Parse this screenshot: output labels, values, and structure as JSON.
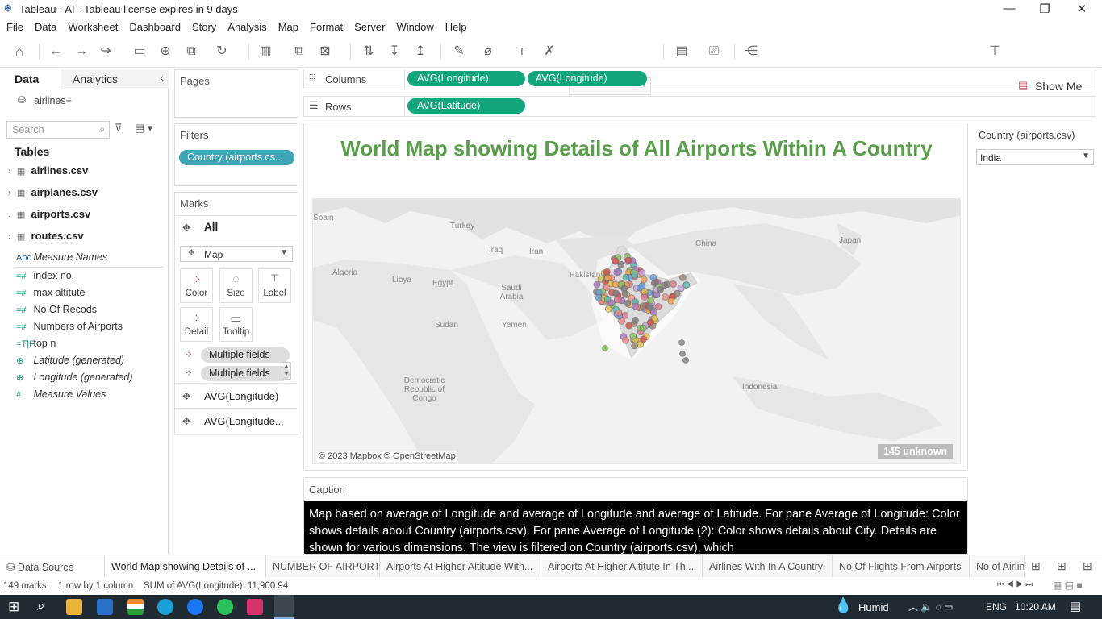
{
  "window": {
    "title": "Tableau - AI - Tableau license expires in 9 days"
  },
  "menu": [
    "File",
    "Data",
    "Worksheet",
    "Dashboard",
    "Story",
    "Analysis",
    "Map",
    "Format",
    "Server",
    "Window",
    "Help"
  ],
  "toolbar": {
    "show_me": "Show Me"
  },
  "data_pane": {
    "tab_data": "Data",
    "tab_analytics": "Analytics",
    "datasource": "airlines+",
    "search_placeholder": "Search",
    "tables_heading": "Tables",
    "tables": [
      "airlines.csv",
      "airplanes.csv",
      "airports.csv",
      "routes.csv"
    ],
    "measure_names": "Measure Names",
    "fields": [
      {
        "icon": "=#",
        "name": "index no."
      },
      {
        "icon": "=#",
        "name": "max altitute"
      },
      {
        "icon": "=#",
        "name": "No Of Recods"
      },
      {
        "icon": "=#",
        "name": "Numbers of Airports"
      },
      {
        "icon": "=T|F",
        "name": "top n"
      }
    ],
    "geo_fields": [
      "Latitude (generated)",
      "Longitude (generated)"
    ],
    "measure_values": "Measure Values"
  },
  "pages": {
    "title": "Pages"
  },
  "filters": {
    "title": "Filters",
    "pill": "Country (airports.cs.."
  },
  "marks": {
    "title": "Marks",
    "all": "All",
    "type": "Map",
    "buttons": [
      "Color",
      "Size",
      "Label",
      "Detail",
      "Tooltip"
    ],
    "fields": [
      "Multiple fields",
      "Multiple fields"
    ],
    "panes": [
      "AVG(Longitude)",
      "AVG(Longitude..."
    ]
  },
  "shelves": {
    "columns_label": "Columns",
    "rows_label": "Rows",
    "columns": [
      "AVG(Longitude)",
      "AVG(Longitude)"
    ],
    "rows": [
      "AVG(Latitude)"
    ]
  },
  "view": {
    "title": "World Map showing Details of All Airports Within A Country",
    "map_labels": [
      "Spain",
      "Turkey",
      "Iraq",
      "Iran",
      "China",
      "Japan",
      "Algeria",
      "Libya",
      "Egypt",
      "Saudi Arabia",
      "Pakistan",
      "Yemen",
      "Sudan",
      "Democratic Republic of Congo",
      "Indonesia"
    ],
    "attribution": "© 2023 Mapbox © OpenStreetMap",
    "unknown": "145 unknown",
    "title_color": "#5a9e4b"
  },
  "filter_card": {
    "title": "Country (airports.csv)",
    "value": "India"
  },
  "caption": {
    "title": "Caption",
    "text": "Map based on average of Longitude and average of Longitude and average of Latitude.  For pane Average of Longitude:  Color shows details about Country (airports.csv).  For pane Average of Longitude (2):  Color shows details about City.  Details are shown for various dimensions. The view is filtered on Country (airports.csv), which"
  },
  "sheet_tabs": [
    "Data Source",
    "World Map showing Details of ...",
    "NUMBER OF AIRPORT",
    "Airports At Higher Altitude  With...",
    "Airports At Higher Altitute In Th...",
    "Airlines With In A Country",
    "No Of Flights From Airports",
    "No of Airlin"
  ],
  "status": {
    "marks": "149 marks",
    "rows": "1 row by 1 column",
    "sum": "SUM of AVG(Longitude): 11,900.94"
  },
  "taskbar": {
    "weather": "Humid",
    "lang": "ENG",
    "time": "10:20 AM"
  }
}
